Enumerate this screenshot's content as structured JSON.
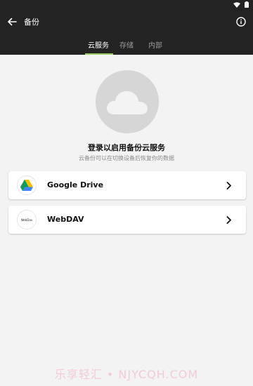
{
  "app_bar": {
    "title": "备份"
  },
  "tabs": [
    {
      "label": "云服务",
      "active": true
    },
    {
      "label": "存储",
      "active": false
    },
    {
      "label": "内部",
      "active": false
    }
  ],
  "content": {
    "login_title": "登录以启用备份云服务",
    "login_subtitle": "云备份可以在切换设备后恢复你的数据",
    "providers": [
      {
        "label": "Google Drive",
        "icon": "google-drive-icon"
      },
      {
        "label": "WebDAV",
        "icon": "webdav-icon",
        "logo_text": "WebDav"
      }
    ]
  },
  "watermark": "乐享轻汇 • NJYCQH.COM",
  "colors": {
    "app_bar_bg": "#232323",
    "tab_underline": "#9ccc65",
    "content_bg": "#f3f3f3",
    "cloud_circle": "#d6d6d6"
  }
}
